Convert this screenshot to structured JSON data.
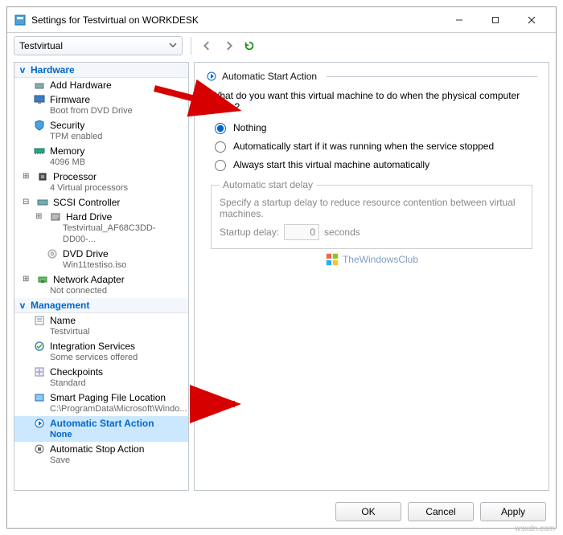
{
  "window": {
    "title": "Settings for Testvirtual on WORKDESK",
    "vm_name": "Testvirtual"
  },
  "sidebar": {
    "hardware_header": "Hardware",
    "management_header": "Management",
    "items": {
      "add_hardware": {
        "label": "Add Hardware"
      },
      "firmware": {
        "label": "Firmware",
        "sub": "Boot from DVD Drive"
      },
      "security": {
        "label": "Security",
        "sub": "TPM enabled"
      },
      "memory": {
        "label": "Memory",
        "sub": "4096 MB"
      },
      "processor": {
        "label": "Processor",
        "sub": "4 Virtual processors"
      },
      "scsi": {
        "label": "SCSI Controller"
      },
      "hard_drive": {
        "label": "Hard Drive",
        "sub": "Testvirtual_AF68C3DD-DD00-..."
      },
      "dvd_drive": {
        "label": "DVD Drive",
        "sub": "Win11testiso.iso"
      },
      "network": {
        "label": "Network Adapter",
        "sub": "Not connected"
      },
      "name": {
        "label": "Name",
        "sub": "Testvirtual"
      },
      "integration": {
        "label": "Integration Services",
        "sub": "Some services offered"
      },
      "checkpoints": {
        "label": "Checkpoints",
        "sub": "Standard"
      },
      "paging": {
        "label": "Smart Paging File Location",
        "sub": "C:\\ProgramData\\Microsoft\\Windo..."
      },
      "auto_start": {
        "label": "Automatic Start Action",
        "sub": "None"
      },
      "auto_stop": {
        "label": "Automatic Stop Action",
        "sub": "Save"
      }
    }
  },
  "pane": {
    "title": "Automatic Start Action",
    "question": "What do you want this virtual machine to do when the physical computer starts?",
    "opt_nothing": "Nothing",
    "opt_auto_running": "Automatically start if it was running when the service stopped",
    "opt_always": "Always start this virtual machine automatically",
    "delay_legend": "Automatic start delay",
    "delay_desc": "Specify a startup delay to reduce resource contention between virtual machines.",
    "delay_label": "Startup delay:",
    "delay_value": "0",
    "delay_unit": "seconds"
  },
  "buttons": {
    "ok": "OK",
    "cancel": "Cancel",
    "apply": "Apply"
  },
  "watermarks": {
    "content": "TheWindowsClub",
    "corner": "wsxdn.com"
  }
}
